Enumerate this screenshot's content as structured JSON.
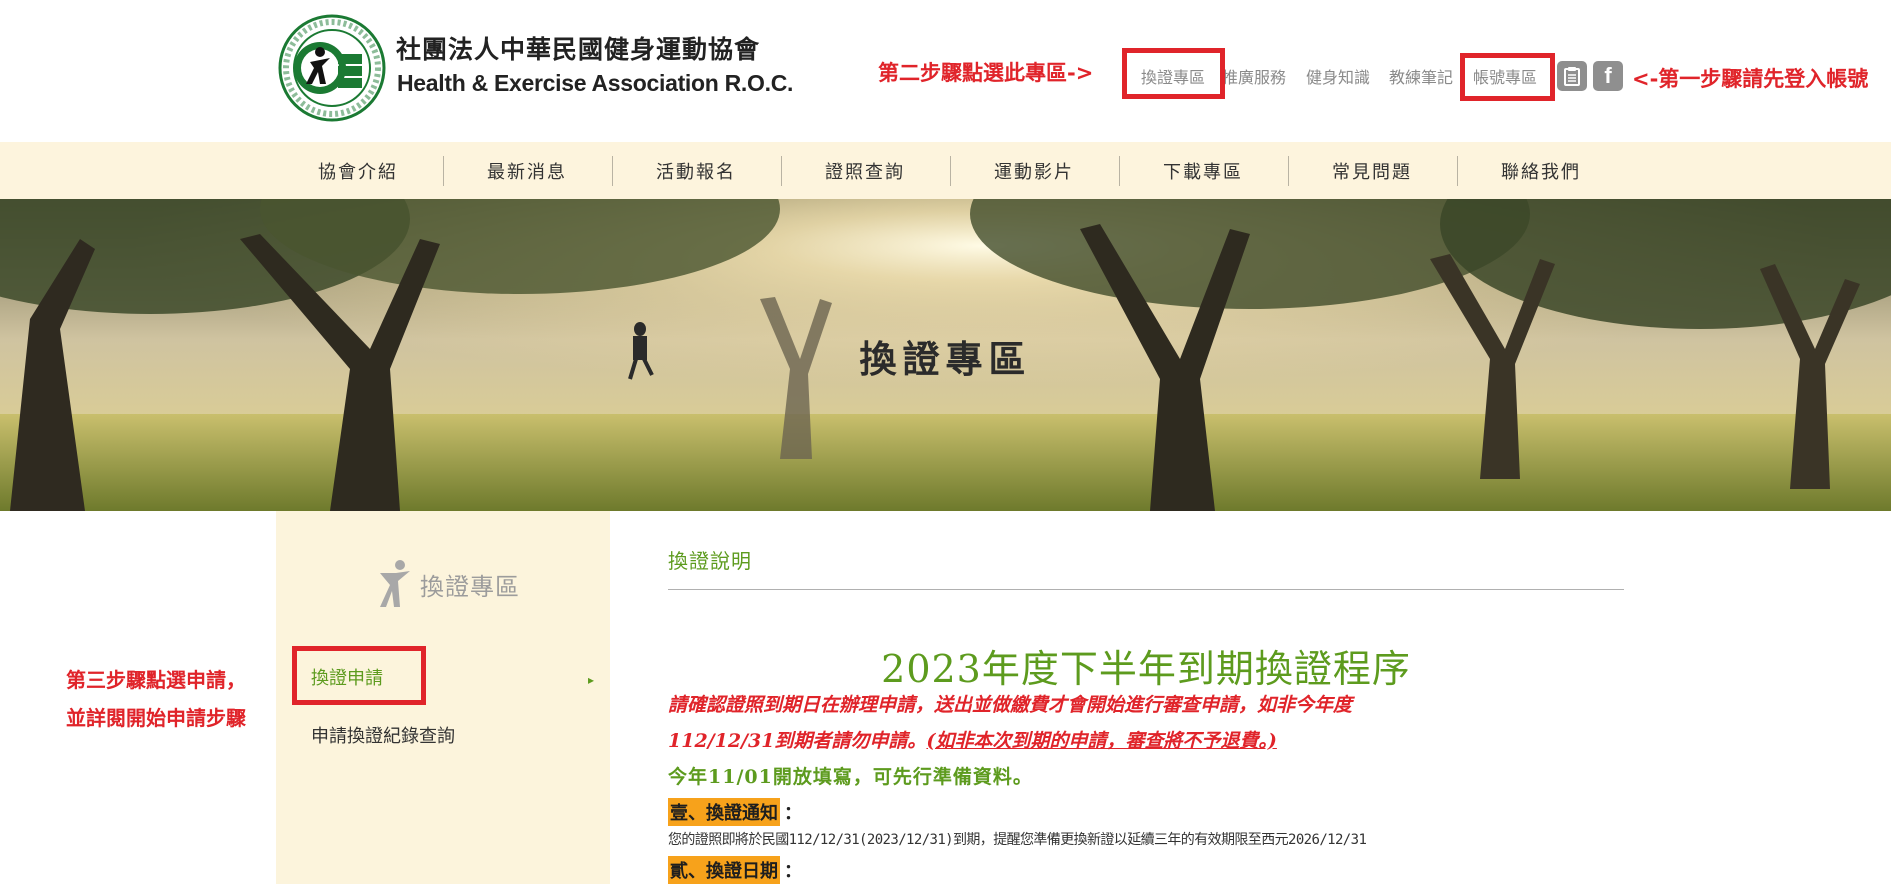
{
  "header": {
    "logo_cn": "社團法人中華民國健身運動協會",
    "logo_en": "Health & Exercise Association R.O.C.",
    "top_links": [
      "換證專區",
      "推廣服務",
      "健身知識",
      "教練筆記",
      "帳號專區"
    ],
    "fb_glyph": "f"
  },
  "annotations": {
    "step2": "第二步驟點選此專區->",
    "step1": "<-第一步驟請先登入帳號",
    "step3_line1": "第三步驟點選申請，",
    "step3_line2": "並詳閱開始申請步驟"
  },
  "nav": {
    "items": [
      "協會介紹",
      "最新消息",
      "活動報名",
      "證照查詢",
      "運動影片",
      "下載專區",
      "常見問題",
      "聯絡我們"
    ]
  },
  "banner": {
    "title": "換證專區"
  },
  "sidebar": {
    "heading": "換證專區",
    "items": [
      "換證申請",
      "申請換證紀錄查詢"
    ],
    "arrow": "▸"
  },
  "content": {
    "title": "換證說明",
    "heading": "2023年度下半年到期換證程序",
    "red_line1": "請確認證照到期日在辦理申請，送出並做繳費才會開始進行審查申請，如非今年度",
    "red_line2_a": "112/12/31到期者請勿申請。",
    "red_line2_b": "(如非本次到期的申請，審查將不予退費。)",
    "green_line": "今年11/01開放填寫，可先行準備資料。",
    "section1_label": "壹、換證通知",
    "section1_text": "您的證照即將於民國112/12/31(2023/12/31)到期，提醒您準備更換新證以延續三年的有效期限至西元2026/12/31",
    "section2_label": "貳、換證日期",
    "colon": "："
  },
  "colors": {
    "brand_green": "#5d9b1e",
    "annotation_red": "#e0242a",
    "nav_bg": "#fdf4dd",
    "highlight_orange": "#f7a21b"
  }
}
